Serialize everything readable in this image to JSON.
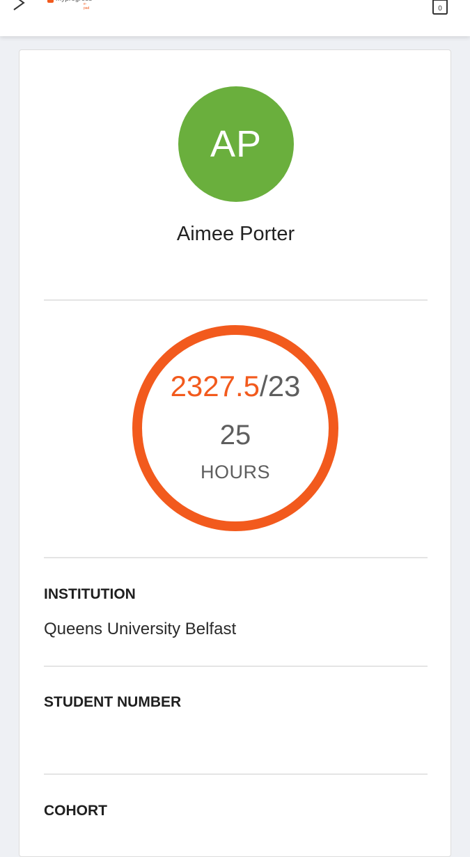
{
  "header": {
    "logo_text": "myprogress",
    "logo_sub": "e-pad",
    "back_icon": "chevron-right-icon",
    "cart_icon": "shopping-bag-icon",
    "cart_count": "0",
    "accent_color": "#f25a1d"
  },
  "profile": {
    "initials": "AP",
    "name": "Aimee Porter",
    "avatar_color": "#6aaf3d"
  },
  "progress": {
    "completed": "2327.5",
    "separator_total": "/23",
    "total_cont": "25",
    "unit": "HOURS",
    "ring_color": "#f25a1d"
  },
  "fields": {
    "institution_label": "INSTITUTION",
    "institution_value": "Queens University Belfast",
    "student_number_label": "STUDENT NUMBER",
    "student_number_value": "",
    "cohort_label": "COHORT"
  }
}
